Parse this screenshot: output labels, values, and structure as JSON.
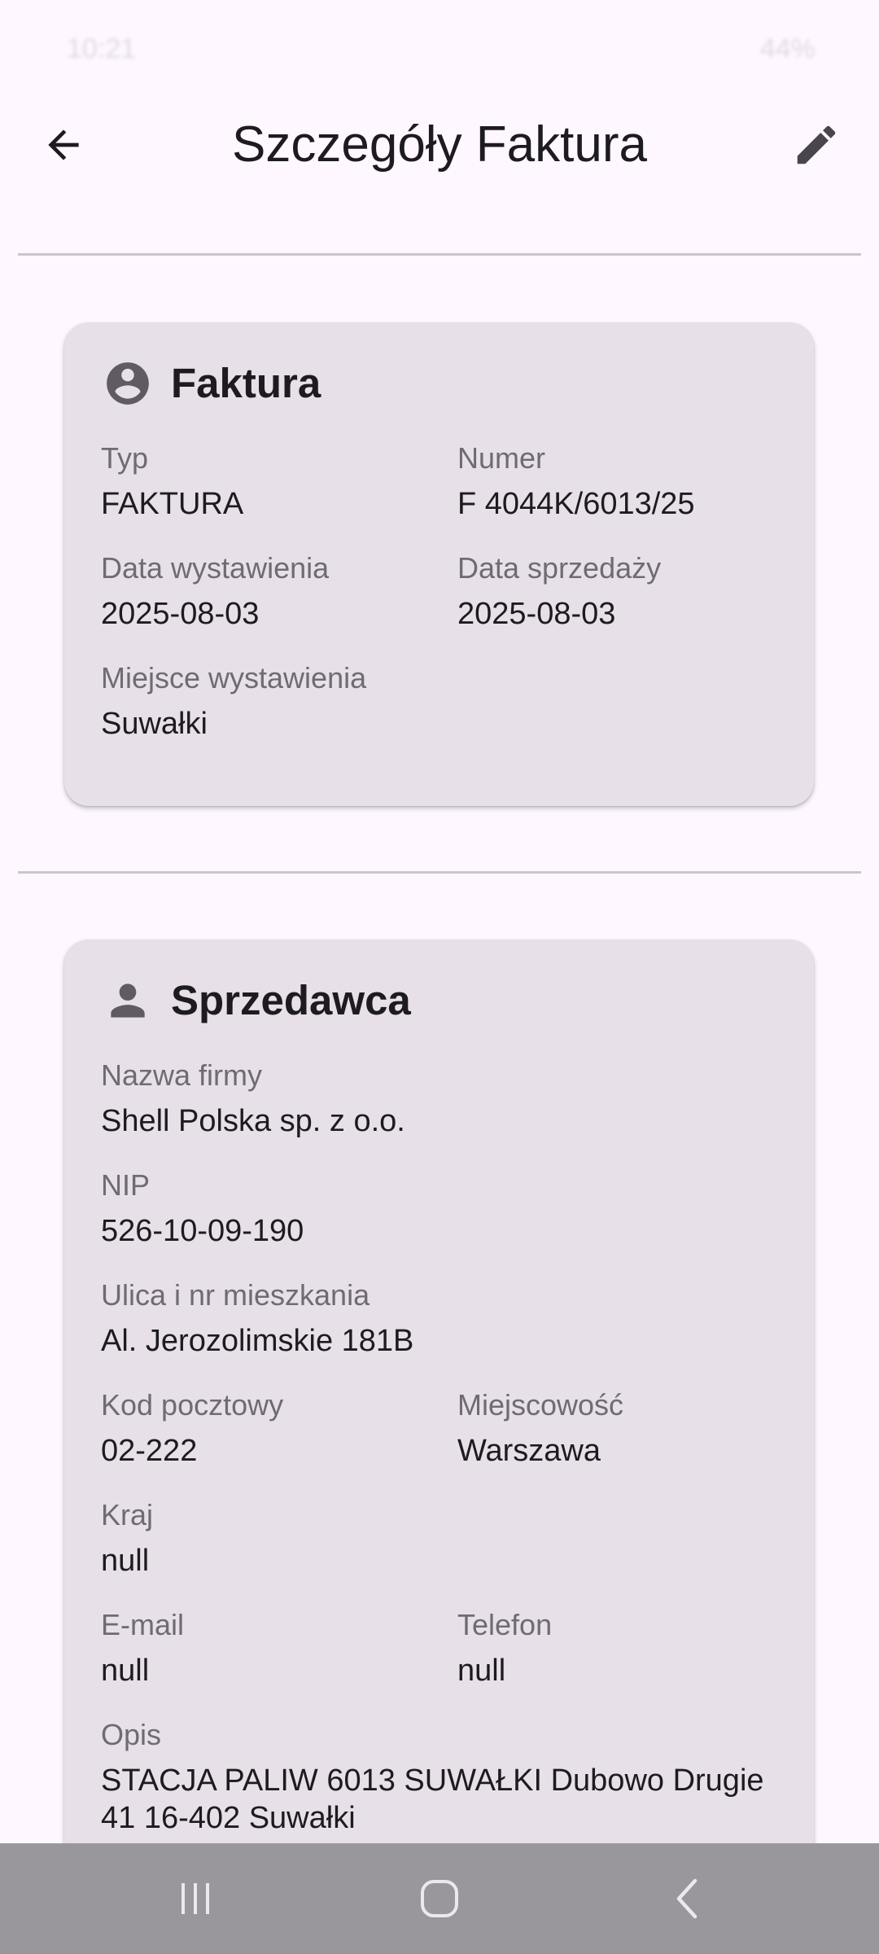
{
  "status_bar": {
    "time": "10:21",
    "battery": "44%"
  },
  "app_bar": {
    "title": "Szczegóły Faktura",
    "back_icon": "arrow-back-icon",
    "edit_icon": "edit-pencil-icon"
  },
  "invoice_card": {
    "icon": "account-circle-icon",
    "title": "Faktura",
    "type_label": "Typ",
    "type_value": "FAKTURA",
    "number_label": "Numer",
    "number_value": "F 4044K/6013/25",
    "issue_date_label": "Data wystawienia",
    "issue_date_value": "2025-08-03",
    "sale_date_label": "Data sprzedaży",
    "sale_date_value": "2025-08-03",
    "place_label": "Miejsce wystawienia",
    "place_value": "Suwałki"
  },
  "seller_card": {
    "icon": "person-icon",
    "title": "Sprzedawca",
    "company_label": "Nazwa firmy",
    "company_value": "Shell Polska sp. z o.o.",
    "nip_label": "NIP",
    "nip_value": "526-10-09-190",
    "street_label": "Ulica i nr mieszkania",
    "street_value": "Al. Jerozolimskie 181B",
    "postal_label": "Kod pocztowy",
    "postal_value": "02-222",
    "city_label": "Miejscowość",
    "city_value": "Warszawa",
    "country_label": "Kraj",
    "country_value": "null",
    "email_label": "E-mail",
    "email_value": "null",
    "phone_label": "Telefon",
    "phone_value": "null",
    "description_label": "Opis",
    "description_value": "STACJA PALIW 6013 SUWAŁKI Dubowo Drugie 41 16-402 Suwałki"
  },
  "nav_bar": {
    "recents_icon": "recent-apps-icon",
    "home_icon": "home-icon",
    "back_icon": "nav-back-icon"
  },
  "colors": {
    "background": "#fef7ff",
    "card": "#e7e0e8",
    "label": "#6f6a73",
    "text": "#1d1b20",
    "nav_bar": "#9a979c"
  }
}
